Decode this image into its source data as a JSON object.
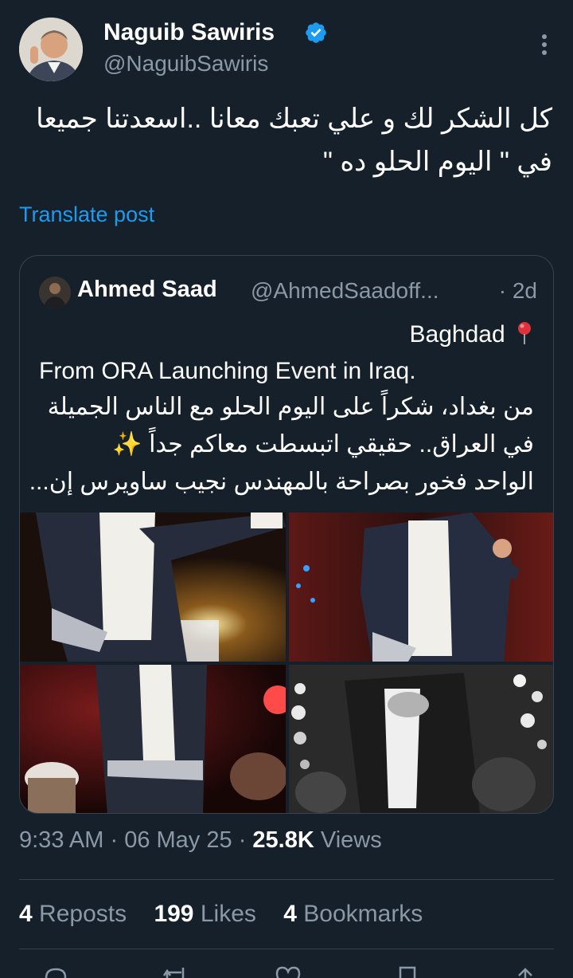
{
  "author": {
    "name": "Naguib Sawiris",
    "handle": "@NaguibSawiris",
    "verified": true,
    "avatar_icon": "person-avatar"
  },
  "post": {
    "text_line1": "كل الشكر لك و علي تعبك معانا ..اسعدتنا جميعا",
    "text_line2": "في \" اليوم الحلو ده \"",
    "translate_label": "Translate post"
  },
  "quote": {
    "name": "Ahmed Saad",
    "handle": "@AhmedSaadoff...",
    "separator": "·",
    "time": "2d",
    "line1": "Baghdad",
    "line2": "From ORA Launching Event in Iraq.",
    "line3": "من بغداد، شكراً على اليوم الحلو مع الناس الجميلة",
    "line4": "في العراق.. حقيقي اتبسطت معاكم جداً",
    "line4_emoji": "✨",
    "line5": "الواحد فخور بصراحة بالمهندس نجيب ساويرس إن..."
  },
  "meta": {
    "time": "9:33 AM",
    "sep1": "·",
    "date": "06 May 25",
    "sep2": "·",
    "views_count": "25.8K",
    "views_label": "Views"
  },
  "stats": {
    "reposts_count": "4",
    "reposts_label": "Reposts",
    "likes_count": "199",
    "likes_label": "Likes",
    "bookmarks_count": "4",
    "bookmarks_label": "Bookmarks"
  },
  "colors": {
    "background": "#15202b",
    "accent": "#1d9bf0",
    "secondary_text": "#8b98a5",
    "border": "#38444d"
  }
}
